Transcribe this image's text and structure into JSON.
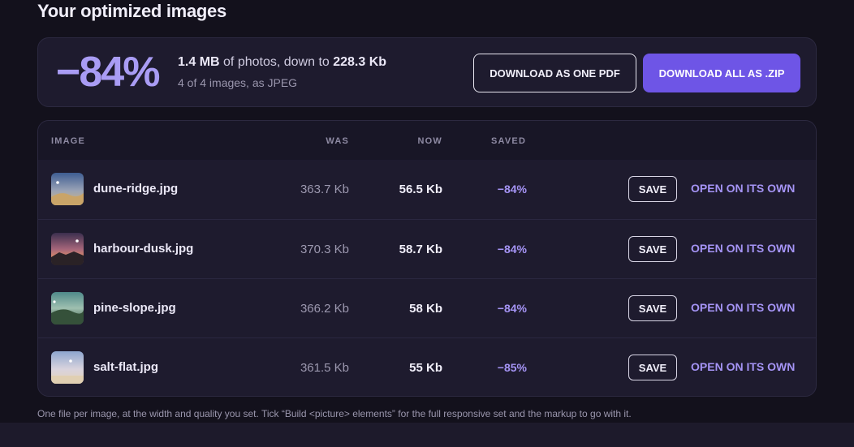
{
  "page_title": "Your optimized images",
  "summary": {
    "percent": "−84%",
    "original_size": "1.4 MB",
    "middle_text": " of photos, down to ",
    "new_size": "228.3 Kb",
    "detail": "4 of 4 images, as JPEG",
    "pdf_button": "DOWNLOAD AS ONE PDF",
    "zip_button": "DOWNLOAD ALL AS .ZIP"
  },
  "table": {
    "headers": {
      "image": "IMAGE",
      "was": "WAS",
      "now": "NOW",
      "saved": "SAVED"
    },
    "rows": [
      {
        "name": "dune-ridge.jpg",
        "was": "363.7 Kb",
        "now": "56.5 Kb",
        "saved": "−84%",
        "save_label": "SAVE",
        "open_label": "OPEN ON ITS OWN"
      },
      {
        "name": "harbour-dusk.jpg",
        "was": "370.3 Kb",
        "now": "58.7 Kb",
        "saved": "−84%",
        "save_label": "SAVE",
        "open_label": "OPEN ON ITS OWN"
      },
      {
        "name": "pine-slope.jpg",
        "was": "366.2 Kb",
        "now": "58 Kb",
        "saved": "−84%",
        "save_label": "SAVE",
        "open_label": "OPEN ON ITS OWN"
      },
      {
        "name": "salt-flat.jpg",
        "was": "361.5 Kb",
        "now": "55 Kb",
        "saved": "−85%",
        "save_label": "SAVE",
        "open_label": "OPEN ON ITS OWN"
      }
    ]
  },
  "footnote": "One file per image, at the width and quality you set. Tick “Build <picture> elements” for the full responsive set and the markup to go with it.",
  "colors": {
    "accent": "#6e55e6",
    "accent_text": "#a594f5",
    "background": "#13111c",
    "card": "#1e1b2e"
  }
}
